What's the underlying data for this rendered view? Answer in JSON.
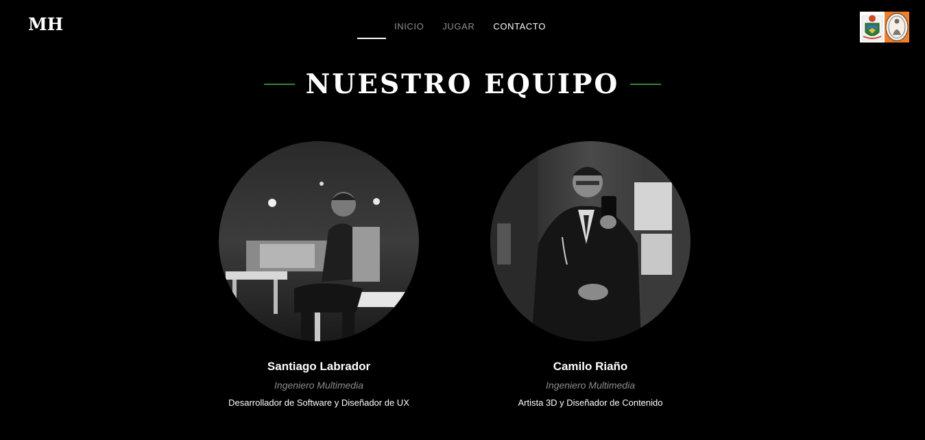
{
  "brand": "MH",
  "nav": {
    "items": [
      {
        "label": "INICIO"
      },
      {
        "label": "JUGAR"
      },
      {
        "label": "CONTACTO"
      }
    ]
  },
  "section": {
    "title": "NUESTRO EQUIPO"
  },
  "team": [
    {
      "name": "Santiago Labrador",
      "role": "Ingeniero Multimedia",
      "description": "Desarrollador de Software y Diseñador de UX"
    },
    {
      "name": "Camilo Riaño",
      "role": "Ingeniero Multimedia",
      "description": "Artista 3D y Diseñador de Contenido"
    }
  ],
  "colors": {
    "background": "#000000",
    "accent_line": "#2f8a3a",
    "nav_inactive": "#8f8f8f",
    "nav_active": "#ffffff",
    "logo_orange": "#f07f2a"
  }
}
